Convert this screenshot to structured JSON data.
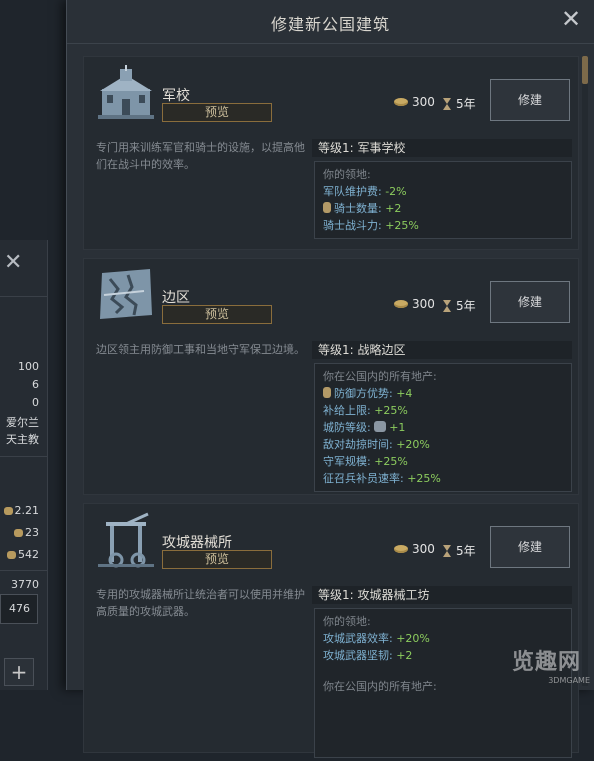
{
  "dialog": {
    "title": "修建新公国建筑",
    "close_icon": "close-icon"
  },
  "buildings": [
    {
      "name": "军校",
      "icon": "military-school-icon",
      "preview_label": "预览",
      "gold_cost": "300",
      "build_time": "5年",
      "build_label": "修建",
      "description": "专门用来训练军官和骑士的设施，以提高他们在战斗中的效率。",
      "level_header": "等级1:  军事学校",
      "scope": "你的领地:",
      "effects": [
        {
          "label": "军队维护费: ",
          "value": "-2%",
          "icon": ""
        },
        {
          "label": "骑士数量: ",
          "value": "+2",
          "icon": "knight-icon"
        },
        {
          "label": "骑士战斗力: ",
          "value": "+25%",
          "icon": ""
        }
      ]
    },
    {
      "name": "边区",
      "icon": "border-map-icon",
      "preview_label": "预览",
      "gold_cost": "300",
      "build_time": "5年",
      "build_label": "修建",
      "description": "边区领主用防御工事和当地守军保卫边境。",
      "level_header": "等级1:  战略边区",
      "scope": "你在公国内的所有地产:",
      "effects": [
        {
          "label": "防御方优势: ",
          "value": "+4",
          "icon": "defense-icon"
        },
        {
          "label": "补给上限: ",
          "value": "+25%",
          "icon": ""
        },
        {
          "label": "城防等级: ",
          "value": "+1",
          "icon": "fort-icon"
        },
        {
          "label": "敌对劫掠时间: ",
          "value": "+20%",
          "icon": ""
        },
        {
          "label": "守军规模: ",
          "value": "+25%",
          "icon": ""
        },
        {
          "label": "征召兵补员速率: ",
          "value": "+25%",
          "icon": ""
        }
      ]
    },
    {
      "name": "攻城器械所",
      "icon": "siege-workshop-icon",
      "preview_label": "预览",
      "gold_cost": "300",
      "build_time": "5年",
      "build_label": "修建",
      "description": "专用的攻城器械所让统治者可以使用并维护高质量的攻城武器。",
      "level_header": "等级1:  攻城器械工坊",
      "scope": "你的领地:",
      "effects": [
        {
          "label": "攻城武器效率: ",
          "value": "+20%",
          "icon": ""
        },
        {
          "label": "攻城武器坚韧: ",
          "value": "+2",
          "icon": ""
        }
      ],
      "scope2": "你在公国内的所有地产:"
    }
  ],
  "side_panel": {
    "close_icon": "close-icon",
    "values": [
      "100",
      "6",
      "0",
      "爱尔兰",
      "天主教",
      "2.21",
      "23",
      "542",
      "3770",
      "476"
    ],
    "plus_label": "+"
  },
  "watermark": {
    "main": "览趣网",
    "sub": "3DMGAME"
  },
  "colors": {
    "accent_gold": "#8a6d3c",
    "positive": "#8ccc5e",
    "effect_label": "#7fb2d2"
  }
}
